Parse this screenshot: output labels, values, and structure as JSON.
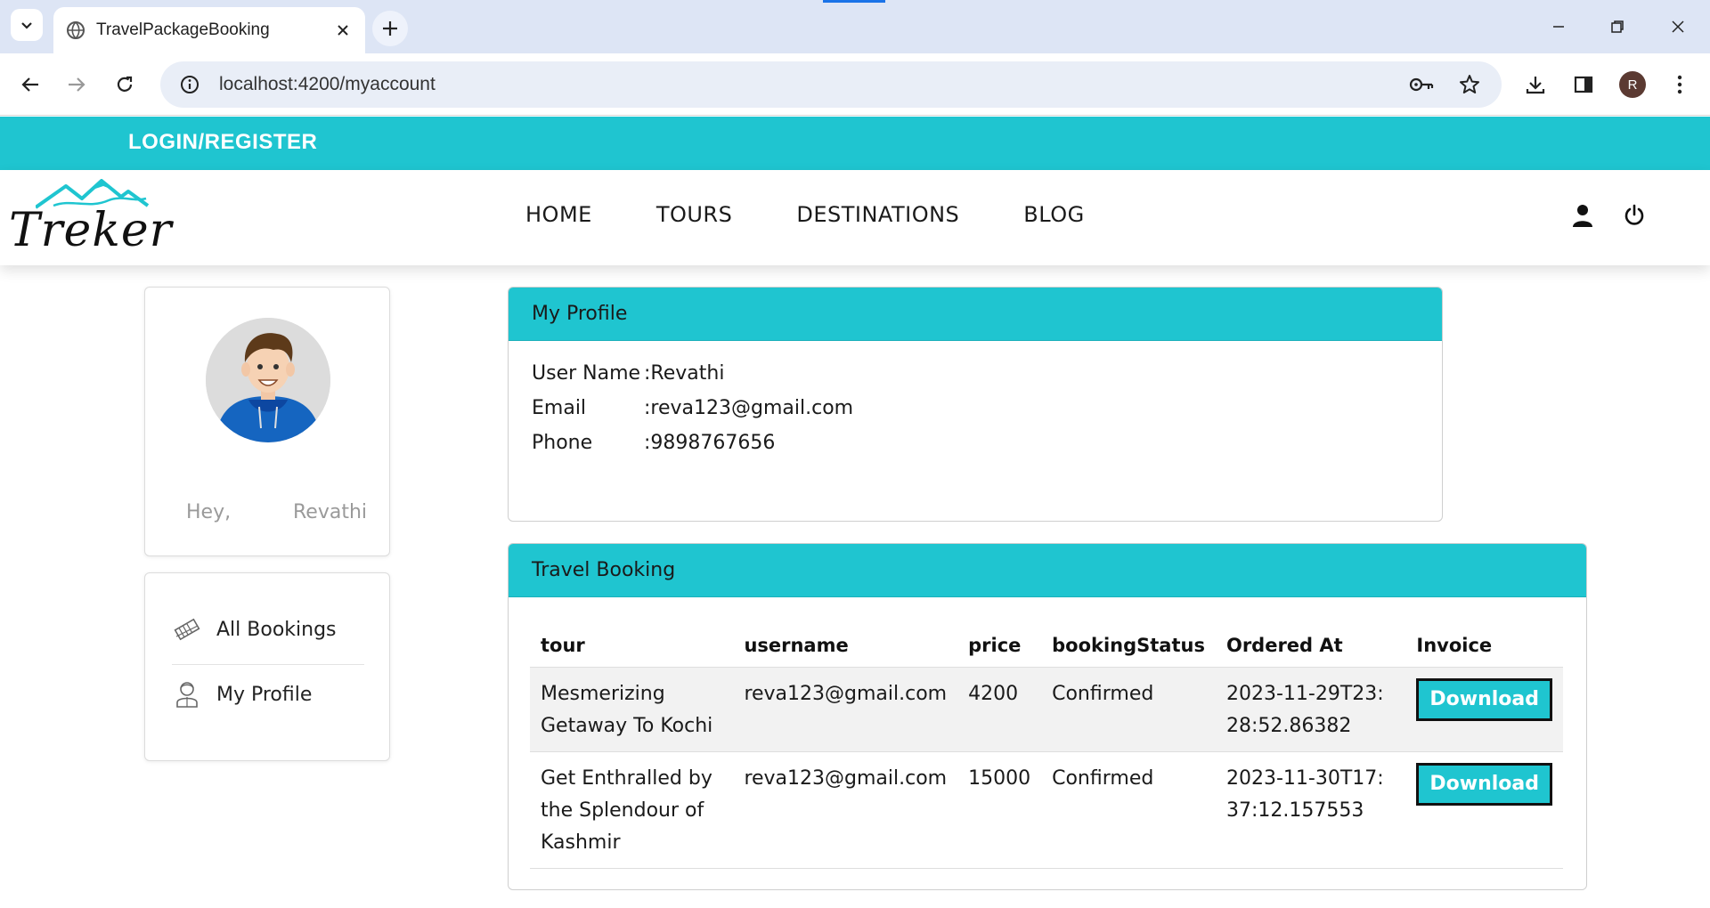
{
  "browser": {
    "tab_title": "TravelPackageBooking",
    "url": "localhost:4200/myaccount",
    "profile_initial": "R"
  },
  "topbar": {
    "login_label": "LOGIN/REGISTER",
    "accent_color": "#1fc5d0"
  },
  "navbar": {
    "logo_text": "Treker",
    "items": [
      "HOME",
      "TOURS",
      "DESTINATIONS",
      "BLOG"
    ]
  },
  "sidebar": {
    "greeting": "Hey,",
    "user_name": "Revathi",
    "menu": [
      {
        "label": "All Bookings",
        "icon": "tickets-icon"
      },
      {
        "label": "My Profile",
        "icon": "user-outline-icon"
      }
    ]
  },
  "profile": {
    "title": "My Profile",
    "rows": [
      {
        "label": "User Name",
        "value": ":Revathi"
      },
      {
        "label": "Email",
        "value": ":reva123@gmail.com"
      },
      {
        "label": "Phone",
        "value": ":9898767656"
      }
    ]
  },
  "bookings": {
    "title": "Travel Booking",
    "columns": [
      "tour",
      "username",
      "price",
      "bookingStatus",
      "Ordered At",
      "Invoice"
    ],
    "rows": [
      {
        "tour": "Mesmerizing Getaway To Kochi",
        "username": "reva123@gmail.com",
        "price": "4200",
        "status": "Confirmed",
        "ordered_at": "2023-11-29T23:28:52.86382",
        "invoice": "Download"
      },
      {
        "tour": "Get Enthralled by the Splendour of Kashmir",
        "username": "reva123@gmail.com",
        "price": "15000",
        "status": "Confirmed",
        "ordered_at": "2023-11-30T17:37:12.157553",
        "invoice": "Download"
      }
    ]
  }
}
